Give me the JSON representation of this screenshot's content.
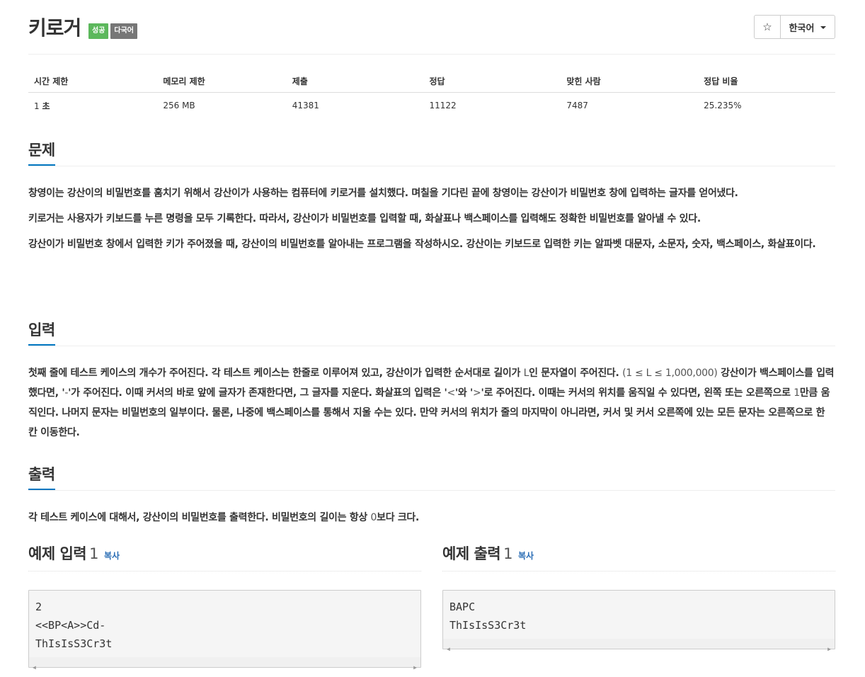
{
  "problem": {
    "title": "키로거",
    "badges": [
      "성공",
      "다국어"
    ],
    "lang_button": "한국어",
    "star_glyph": "☆"
  },
  "stats": {
    "headers": [
      "시간 제한",
      "메모리 제한",
      "제출",
      "정답",
      "맞힌 사람",
      "정답 비율"
    ],
    "time_value": "1 ",
    "time_unit": "초",
    "memory": "256 MB",
    "submissions": "41381",
    "accepted": "11122",
    "solvers": "7487",
    "ratio": "25.235%"
  },
  "description": {
    "heading": "문제",
    "p1": "창영이는 강산이의 비밀번호를 훔치기 위해서 강산이가 사용하는 컴퓨터에 키로거를 설치했다. 며칠을 기다린 끝에 창영이는 강산이가 비밀번호 창에 입력하는 글자를 얻어냈다.",
    "p2": "키로거는 사용자가 키보드를 누른 명령을 모두 기록한다. 따라서, 강산이가 비밀번호를 입력할 때, 화살표나 백스페이스를 입력해도 정확한 비밀번호를 알아낼 수 있다.",
    "p3": "강산이가 비밀번호 창에서 입력한 키가 주어졌을 때, 강산이의 비밀번호를 알아내는 프로그램을 작성하시오. 강산이는 키보드로 입력한 키는 알파벳 대문자, 소문자, 숫자, 백스페이스, 화살표이다."
  },
  "input": {
    "heading": "입력",
    "t1": "첫째 줄에 테스트 케이스의 개수가 주어진다. 각 테스트 케이스는 한줄로 이루어져 있고, 강산이가 입력한 순서대로 길이가 ",
    "t2": "L",
    "t3": "인 문자열이 주어진다. ",
    "t4": "(1 ≤ L ≤ 1,000,000)",
    "t5": " 강산이가 백스페이스를 입력했다면, '",
    "t6": "-",
    "t7": "'가 주어진다. 이때 커서의 바로 앞에 글자가 존재한다면, 그 글자를 지운다. 화살표의 입력은 '",
    "t8": "<",
    "t9": "'와 '",
    "t10": ">",
    "t11": "'로 주어진다. 이때는 커서의 위치를 움직일 수 있다면, 왼쪽 또는 오른쪽으로 ",
    "t12": "1",
    "t13": "만큼 움직인다. 나머지 문자는 비밀번호의 일부이다. 물론, 나중에 백스페이스를 통해서 지울 수는 있다. 만약 커서의 위치가 줄의 마지막이 아니라면, 커서 및 커서 오른쪽에 있는 모든 문자는 오른쪽으로 한 칸 이동한다."
  },
  "output": {
    "heading": "출력",
    "t1": "각 테스트 케이스에 대해서, 강산이의 비밀번호를 출력한다. 비밀번호의 길이는 항상 ",
    "t2": "0",
    "t3": "보다 크다."
  },
  "sample_input": {
    "heading": "예제 입력",
    "num": "1",
    "copy": "복사",
    "lines": [
      "2",
      "<<BP<A>>Cd-",
      "ThIsIsS3Cr3t"
    ]
  },
  "sample_output": {
    "heading": "예제 출력",
    "num": "1",
    "copy": "복사",
    "lines": [
      "BAPC",
      "ThIsIsS3Cr3t"
    ]
  },
  "colors": {
    "success_badge": "#5cb85c",
    "lang_badge": "#777777",
    "heading_underline": "#0076c0",
    "copy_link": "#2a6db5"
  }
}
